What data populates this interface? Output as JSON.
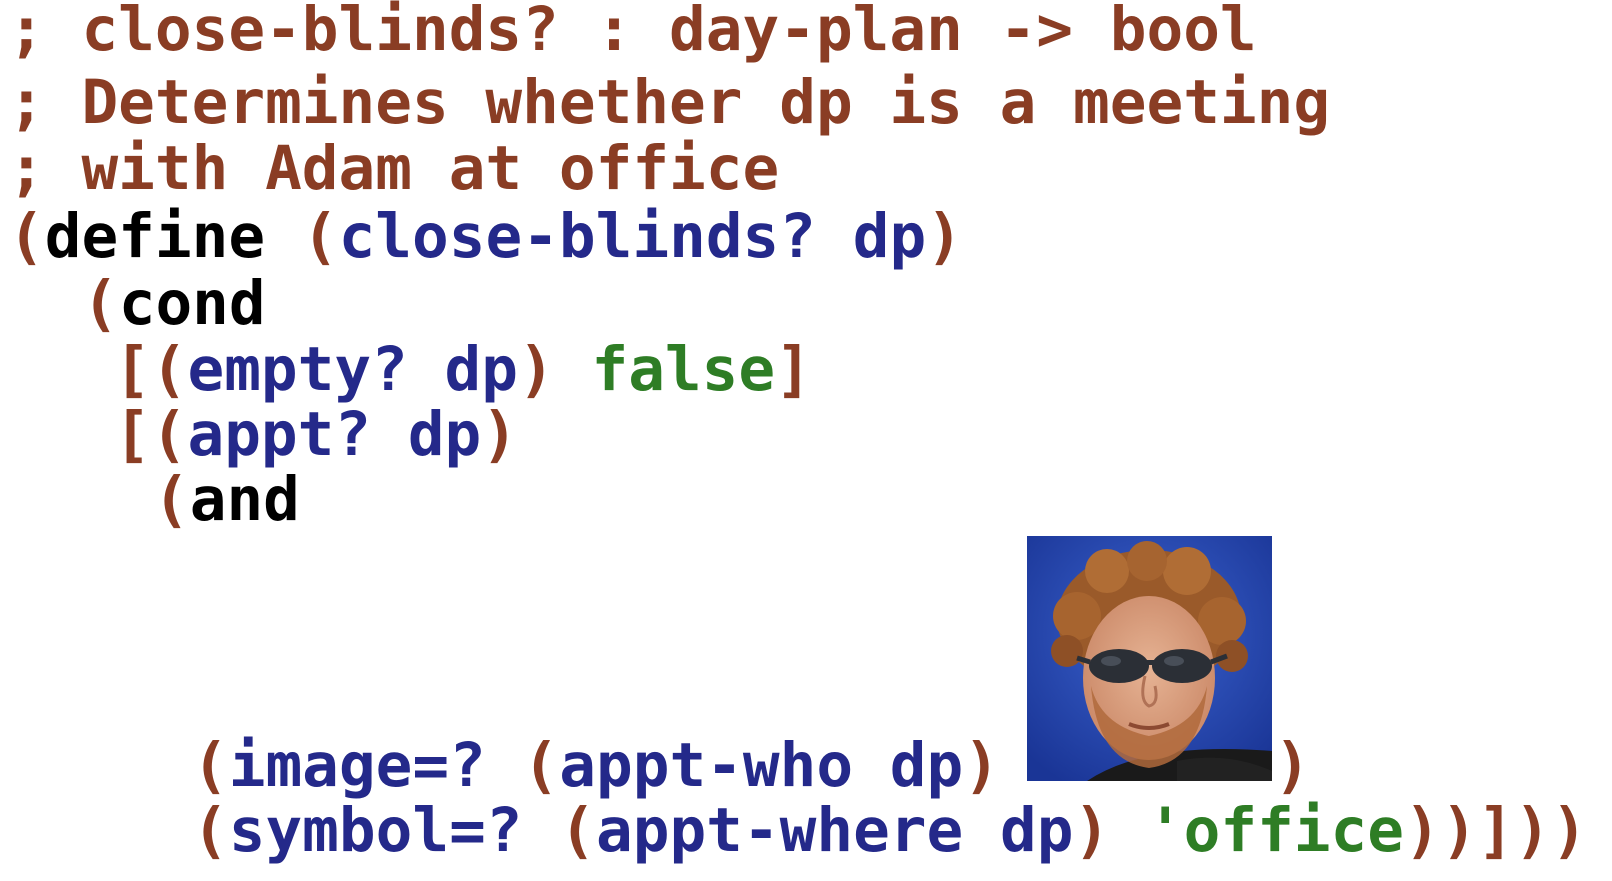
{
  "code": {
    "comment_1": "; close-blinds? : day-plan -> bool",
    "comment_2": "; Determines whether dp is a meeting",
    "comment_3": "; with Adam at office",
    "open_paren": "(",
    "close_paren": ")",
    "open_bracket": "[",
    "close_bracket": "]",
    "kw_define": "define",
    "kw_cond": "cond",
    "kw_and": "and",
    "fn_signature": "close-blinds? dp",
    "empty_test": "empty? dp",
    "false_value": "false",
    "appt_test": "appt? dp",
    "image_eq": "image=? ",
    "appt_who_call": "appt-who dp",
    "symbol_eq": "symbol=? ",
    "appt_where_call": "appt-where dp",
    "office_symbol": "'office",
    "tail_closers": "))]))"
  },
  "image": {
    "subject": "photo of Adam (man with curly red hair, beard and sunglasses)",
    "background_color": "#1f3fa8"
  }
}
